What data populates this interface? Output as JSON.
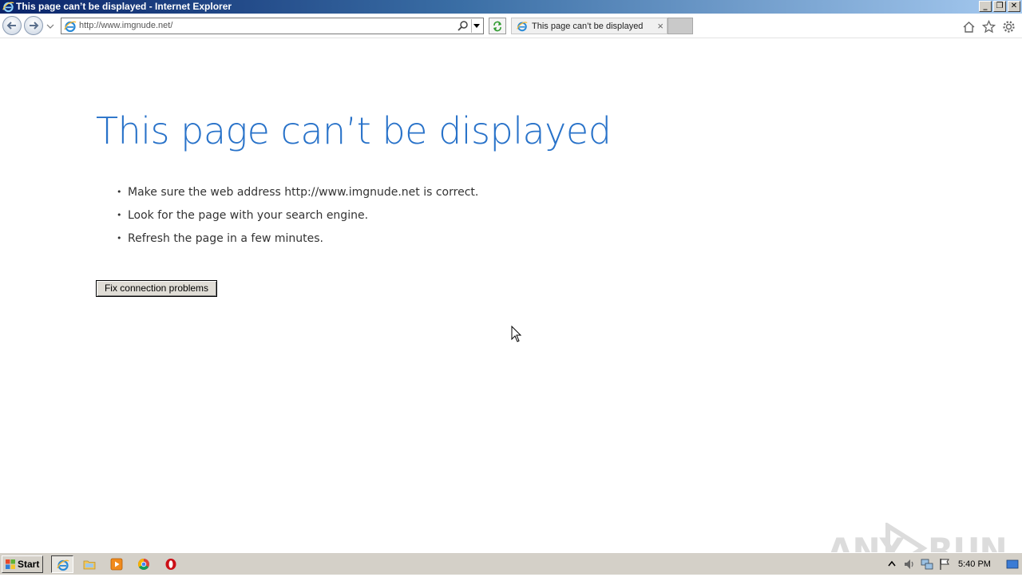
{
  "window": {
    "title": "This page can’t be displayed - Internet Explorer",
    "controls": [
      "minimize",
      "restore",
      "close"
    ]
  },
  "toolbar": {
    "address_url": "http://www.imgnude.net/",
    "tab_title": "This page can’t be displayed",
    "tab_close": "×",
    "icons": [
      "back-icon",
      "forward-icon",
      "search-icon",
      "refresh-icon",
      "home-icon",
      "favorites-star-icon",
      "settings-gear-icon"
    ]
  },
  "error": {
    "title": "This page can’t be displayed",
    "bullets": [
      "Make sure the web address http://www.imgnude.net is correct.",
      "Look for the page with your search engine.",
      "Refresh the page in a few minutes."
    ],
    "fix_button": "Fix connection problems"
  },
  "watermark": {
    "left": "ANY",
    "right": "RUN"
  },
  "taskbar": {
    "start_label": "Start",
    "apps": [
      "internet-explorer",
      "file-explorer",
      "media-player",
      "chrome",
      "opera"
    ],
    "clock": "5:40 PM"
  },
  "colors": {
    "title_blue": "#2872c9",
    "taskbar": "#d4d0c8",
    "titlebar_dark": "#0a246a"
  }
}
